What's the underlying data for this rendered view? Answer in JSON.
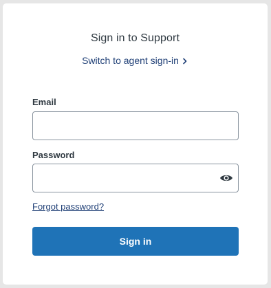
{
  "header": {
    "title": "Sign in to Support",
    "switch_link": "Switch to agent sign-in"
  },
  "form": {
    "email_label": "Email",
    "email_value": "",
    "password_label": "Password",
    "password_value": "",
    "forgot_link": "Forgot password?",
    "submit_label": "Sign in"
  },
  "icons": {
    "switch_chevron": "chevron-right-icon",
    "password_toggle": "eye-icon"
  },
  "colors": {
    "primary": "#1f73b7",
    "link": "#1f3f76",
    "text": "#2f3941",
    "border": "#87929d",
    "backdrop": "#e6e6e6"
  }
}
